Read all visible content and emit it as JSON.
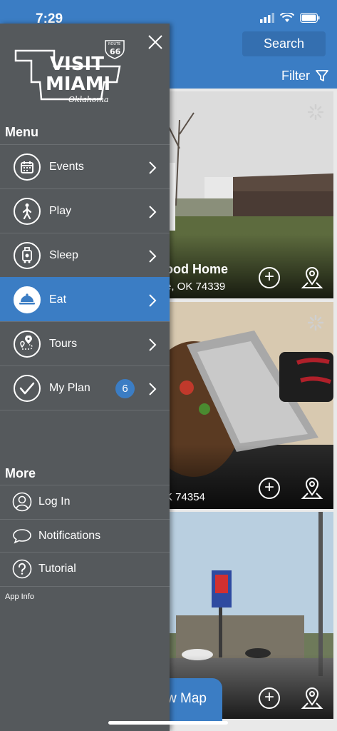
{
  "status_bar": {
    "time": "7:29"
  },
  "header": {
    "search_label": "Search",
    "filter_label": "Filter"
  },
  "cards": [
    {
      "title": "ood Home",
      "address": "e, OK 74339",
      "add_label": "+"
    },
    {
      "title": "",
      "address": "K 74354",
      "add_label": "+"
    },
    {
      "title": "",
      "address": "",
      "add_label": "+"
    }
  ],
  "view_map_label": "w Map",
  "logo": {
    "line1": "VISIT",
    "line2": "MIAMI",
    "line3": "Oklahoma",
    "shield_top": "ROUTE",
    "shield_num": "66"
  },
  "menu": {
    "heading": "Menu",
    "items": [
      {
        "label": "Events",
        "icon": "calendar-icon"
      },
      {
        "label": "Play",
        "icon": "walking-person-icon"
      },
      {
        "label": "Sleep",
        "icon": "luggage-icon"
      },
      {
        "label": "Eat",
        "icon": "food-cloche-icon",
        "active": true
      },
      {
        "label": "Tours",
        "icon": "map-pin-route-icon"
      },
      {
        "label": "My Plan",
        "icon": "checkmark-icon",
        "badge": "6"
      }
    ]
  },
  "more": {
    "heading": "More",
    "items": [
      {
        "label": "Log In",
        "icon": "user-icon"
      },
      {
        "label": "Notifications",
        "icon": "chat-bubble-icon"
      },
      {
        "label": "Tutorial",
        "icon": "question-icon"
      }
    ],
    "app_info": "App Info"
  },
  "colors": {
    "accent": "#3b7dc4",
    "drawer": "#55595c"
  }
}
